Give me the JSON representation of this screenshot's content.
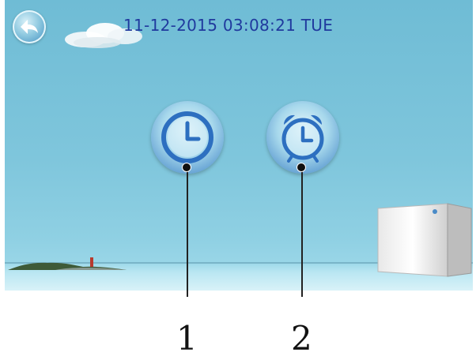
{
  "header": {
    "datetime": "11-12-2015  03:08:21  TUE"
  },
  "icons": {
    "back": "back-arrow-icon",
    "clock": "clock-icon",
    "alarm": "alarm-clock-icon"
  },
  "callouts": [
    {
      "number": "1",
      "target": "clock-button"
    },
    {
      "number": "2",
      "target": "alarm-button"
    }
  ],
  "colors": {
    "sky": "#7fc6dc",
    "datetime_text": "#203a9e",
    "button_blue": "#3b7fc4"
  }
}
